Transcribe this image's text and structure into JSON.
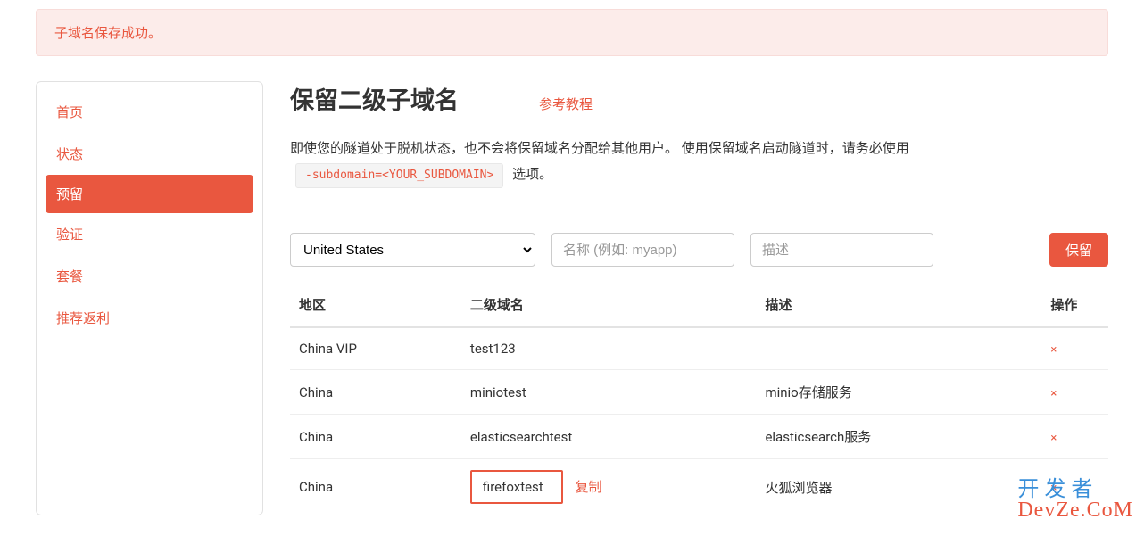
{
  "alert": {
    "message": "子域名保存成功。"
  },
  "sidebar": {
    "items": [
      {
        "label": "首页"
      },
      {
        "label": "状态"
      },
      {
        "label": "预留"
      },
      {
        "label": "验证"
      },
      {
        "label": "套餐"
      },
      {
        "label": "推荐返利"
      }
    ]
  },
  "page": {
    "title": "保留二级子域名",
    "tutorial": "参考教程",
    "desc_pre": "即使您的隧道处于脱机状态，也不会将保留域名分配给其他用户。 使用保留域名启动隧道时，请务必使用",
    "desc_code": "-subdomain=<YOUR_SUBDOMAIN>",
    "desc_post": "选项。"
  },
  "controls": {
    "region_selected": "United States",
    "name_placeholder": "名称 (例如: myapp)",
    "desc_placeholder": "描述",
    "reserve_button": "保留"
  },
  "table": {
    "headers": {
      "region": "地区",
      "domain": "二级域名",
      "desc": "描述",
      "action": "操作"
    },
    "rows": [
      {
        "region": "China VIP",
        "domain": "test123",
        "desc": ""
      },
      {
        "region": "China",
        "domain": "miniotest",
        "desc": "minio存储服务"
      },
      {
        "region": "China",
        "domain": "elasticsearchtest",
        "desc": "elasticsearch服务"
      },
      {
        "region": "China",
        "domain": "firefoxtest",
        "desc": "火狐浏览器",
        "highlighted": true
      }
    ],
    "copy_label": "复制",
    "delete_icon": "×"
  },
  "watermark": {
    "top": "开发者",
    "bottom": "DevZe.CoM"
  }
}
